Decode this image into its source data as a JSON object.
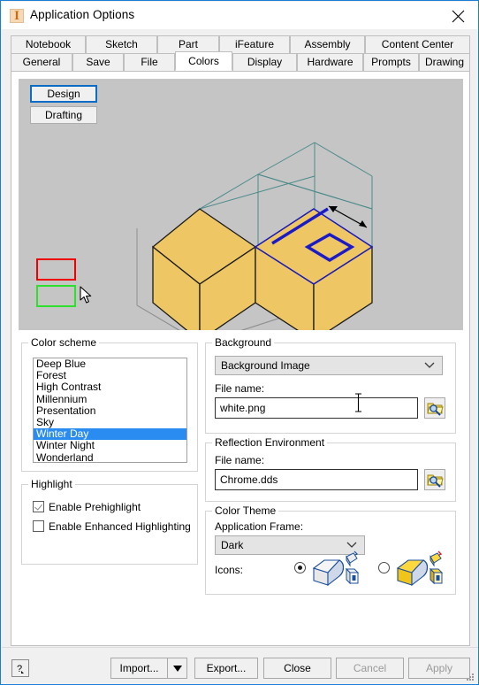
{
  "window": {
    "title": "Application Options",
    "icon": "inventor-app-icon",
    "icon_glyph": "I",
    "close_icon": "close-icon"
  },
  "tabs": {
    "top_row": [
      {
        "label": "Notebook",
        "selected": false
      },
      {
        "label": "Sketch",
        "selected": false
      },
      {
        "label": "Part",
        "selected": false
      },
      {
        "label": "iFeature",
        "selected": false
      },
      {
        "label": "Assembly",
        "selected": false
      },
      {
        "label": "Content Center",
        "selected": false
      }
    ],
    "bottom_row": [
      {
        "label": "General",
        "selected": false
      },
      {
        "label": "Save",
        "selected": false
      },
      {
        "label": "File",
        "selected": false
      },
      {
        "label": "Colors",
        "selected": true
      },
      {
        "label": "Display",
        "selected": false
      },
      {
        "label": "Hardware",
        "selected": false
      },
      {
        "label": "Prompts",
        "selected": false
      },
      {
        "label": "Drawing",
        "selected": false
      }
    ]
  },
  "preview": {
    "design_button": "Design",
    "drafting_button": "Drafting",
    "background_color": "#c5c5c5",
    "model_face_color": "#eec764",
    "wireframe_color": "#4c8a8a",
    "ground_wireframe_color": "#8f8f8f",
    "sketch_color": "#1a1ac8",
    "swatch_red": "#ee0000",
    "swatch_green": "#2ee02e",
    "cursor": "mouse-pointer"
  },
  "color_scheme": {
    "legend": "Color scheme",
    "items": [
      {
        "label": "Deep Blue",
        "selected": false
      },
      {
        "label": "Forest",
        "selected": false
      },
      {
        "label": "High Contrast",
        "selected": false
      },
      {
        "label": "Millennium",
        "selected": false
      },
      {
        "label": "Presentation",
        "selected": false
      },
      {
        "label": "Sky",
        "selected": false
      },
      {
        "label": "Winter Day",
        "selected": true
      },
      {
        "label": "Winter Night",
        "selected": false
      },
      {
        "label": "Wonderland",
        "selected": false
      }
    ],
    "selection_color": "#2a8cf0"
  },
  "highlight": {
    "legend": "Highlight",
    "prehighlight_label": "Enable Prehighlight",
    "prehighlight_checked": true,
    "enhanced_label": "Enable Enhanced Highlighting",
    "enhanced_checked": false
  },
  "background": {
    "legend": "Background",
    "selected_option": "Background Image",
    "options": [
      "Background Image"
    ],
    "file_label": "File name:",
    "file_value": "white.png",
    "browse_icon": "folder-search-icon"
  },
  "reflection": {
    "legend": "Reflection Environment",
    "file_label": "File name:",
    "file_value": "Chrome.dds",
    "browse_icon": "folder-search-icon"
  },
  "color_theme": {
    "legend": "Color Theme",
    "frame_label": "Application Frame:",
    "frame_value": "Dark",
    "icons_label": "Icons:",
    "option_light_selected": true,
    "option_amber_selected": false,
    "light_icon_name": "light-icon-set",
    "amber_icon_name": "amber-icon-set"
  },
  "footer": {
    "help_label": "?",
    "import_label": "Import...",
    "import_dropdown_icon": "caret-down-icon",
    "export_label": "Export...",
    "close_label": "Close",
    "cancel_label": "Cancel",
    "cancel_disabled": true,
    "apply_label": "Apply",
    "apply_disabled": true,
    "resize_grip": "resize-grip-icon"
  }
}
